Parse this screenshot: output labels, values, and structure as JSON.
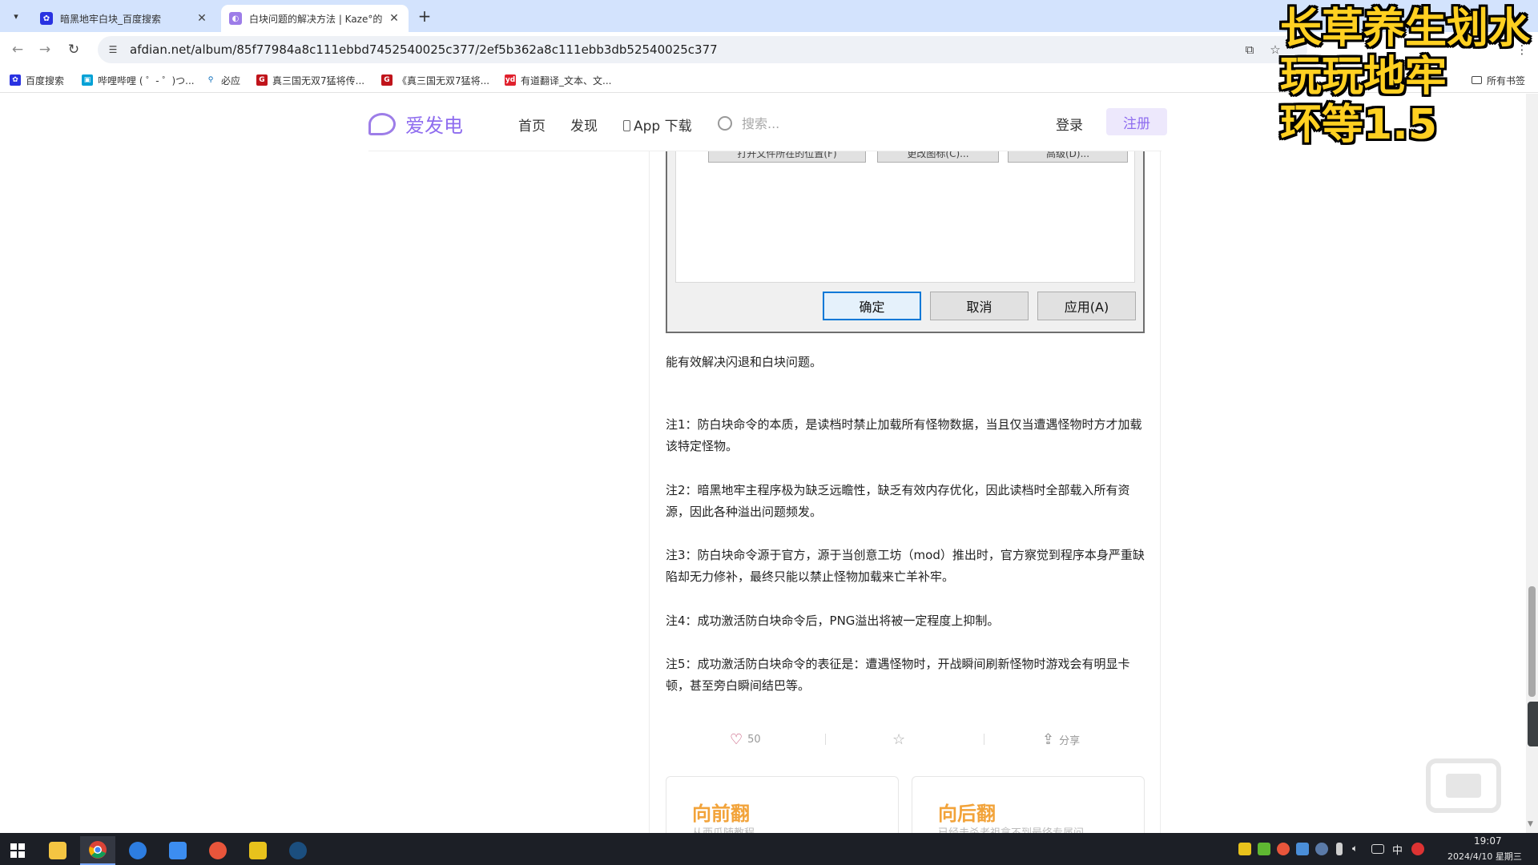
{
  "browser": {
    "tabs": [
      {
        "title": "暗黑地牢白块_百度搜索",
        "favicon": "baidu-paw-icon",
        "active": false
      },
      {
        "title": "白块问题的解决方法 | Kaze°的",
        "favicon": "afdian-icon",
        "active": true
      }
    ],
    "url": "afdian.net/album/85f77984a8c111ebbd7452540025c377/2ef5b362a8c111ebb3db52540025c377",
    "bookmarks": [
      {
        "label": "百度搜索",
        "icon": "baidu-icon",
        "color": "#2932e1"
      },
      {
        "label": "哔哩哔哩 ( ゜- ゜)つ...",
        "icon": "bilibili-icon",
        "color": "#00a1d6"
      },
      {
        "label": "必应",
        "icon": "search-icon",
        "color": "#0067b8"
      },
      {
        "label": "真三国无双7猛将传...",
        "icon": "game-g-icon",
        "color": "#c0141b"
      },
      {
        "label": "《真三国无双7猛将...",
        "icon": "game-g-icon",
        "color": "#c0141b"
      },
      {
        "label": "有道翻译_文本、文...",
        "icon": "youdao-icon",
        "color": "#e0212d"
      }
    ],
    "all_bookmarks": "所有书签"
  },
  "site": {
    "logo_text": "爱发电",
    "nav": [
      "首页",
      "发现",
      "App 下载"
    ],
    "search_placeholder": "搜索...",
    "login": "登录",
    "register": "注册"
  },
  "dialog": {
    "buttons": [
      "确定",
      "取消",
      "应用(A)"
    ],
    "cut_buttons": [
      "打开文件所在的位置(F)",
      "更改图标(C)...",
      "高级(D)..."
    ]
  },
  "article": {
    "lead": "能有效解决闪退和白块问题。",
    "notes": [
      "注1：防白块命令的本质，是读档时禁止加载所有怪物数据，当且仅当遭遇怪物时方才加载该特定怪物。",
      "注2：暗黑地牢主程序极为缺乏远瞻性，缺乏有效内存优化，因此读档时全部载入所有资源，因此各种溢出问题频发。",
      "注3：防白块命令源于官方，源于当创意工坊（mod）推出时，官方察觉到程序本身严重缺陷却无力修补，最终只能以禁止怪物加载来亡羊补牢。",
      "注4：成功激活防白块命令后，PNG溢出将被一定程度上抑制。",
      "注5：成功激活防白块命令的表征是：遭遇怪物时，开战瞬间刷新怪物时游戏会有明显卡顿，甚至旁白瞬间结巴等。"
    ],
    "likes": "50",
    "share": "分享"
  },
  "pager": {
    "prev_title": "向前翻",
    "prev_sub": "从西瓜随教程",
    "next_title": "向后翻",
    "next_sub": "已经击杀老祖拿不到最终专属问"
  },
  "overlay": {
    "lines": [
      "长草养生划水",
      "玩玩地牢",
      "环等1.5"
    ],
    "color": "#ffd021"
  },
  "taskbar": {
    "time": "19:07",
    "date": "2024/4/10 星期三",
    "ime": "中"
  }
}
